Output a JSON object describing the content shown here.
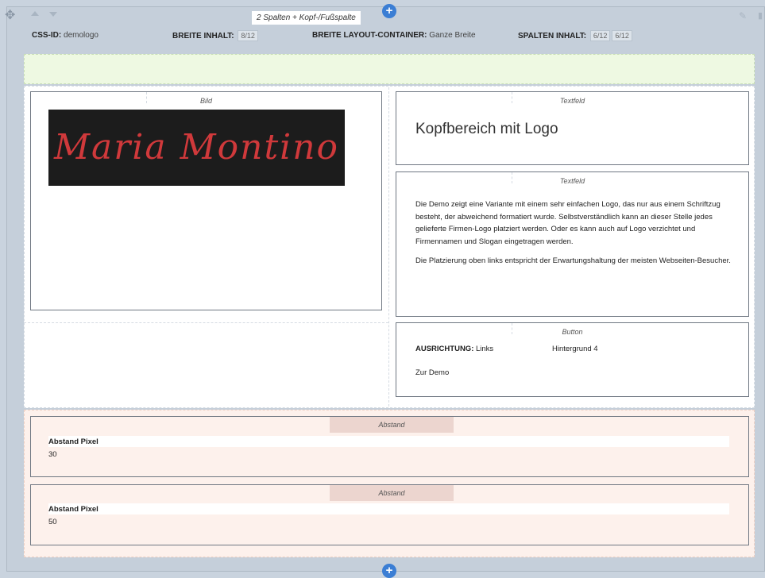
{
  "module": {
    "title": "2 Spalten + Kopf-/Fußspalte",
    "meta": {
      "css_id_label": "CSS-ID:",
      "css_id_value": "demologo",
      "breite_inhalt_label": "BREITE INHALT:",
      "breite_inhalt_value": "8/12",
      "breite_container_label": "BREITE LAYOUT-CONTAINER:",
      "breite_container_value": "Ganze Breite",
      "spalten_inhalt_label": "SPALTEN INHALT:",
      "spalten_inhalt_values": [
        "6/12",
        "6/12"
      ]
    },
    "icons": [
      "move-icon",
      "arrow-up-icon",
      "arrow-down-icon",
      "pencil-icon",
      "trash-icon",
      "plus-icon"
    ],
    "accent_color": "#3b7ed4"
  },
  "left_column": {
    "bild": {
      "label": "Bild",
      "logo_text": "Maria Montino"
    }
  },
  "right_column": {
    "heading_field": {
      "label": "Textfeld",
      "text": "Kopfbereich mit Logo"
    },
    "body_field": {
      "label": "Textfeld",
      "paragraph_1": "Die Demo zeigt eine Variante mit einem sehr einfachen Logo, das nur aus einem Schriftzug besteht, der abweichend formatiert wurde. Selbstverständlich kann an dieser Stelle jedes gelieferte Firmen-Logo platziert werden. Oder es kann auch auf Logo verzichtet und Firmennamen und Slogan eingetragen werden.",
      "paragraph_2": "Die Platzierung oben links entspricht der Erwartungshaltung der meisten Webseiten-Besucher."
    },
    "button_field": {
      "label": "Button",
      "ausrichtung_label": "AUSRICHTUNG:",
      "ausrichtung_value": "Links",
      "hintergrund": "Hintergrund 4",
      "button_text": "Zur Demo"
    }
  },
  "footer": {
    "spacers": [
      {
        "label": "Abstand",
        "field_label": "Abstand Pixel",
        "value": "30"
      },
      {
        "label": "Abstand",
        "field_label": "Abstand Pixel",
        "value": "50"
      }
    ]
  }
}
